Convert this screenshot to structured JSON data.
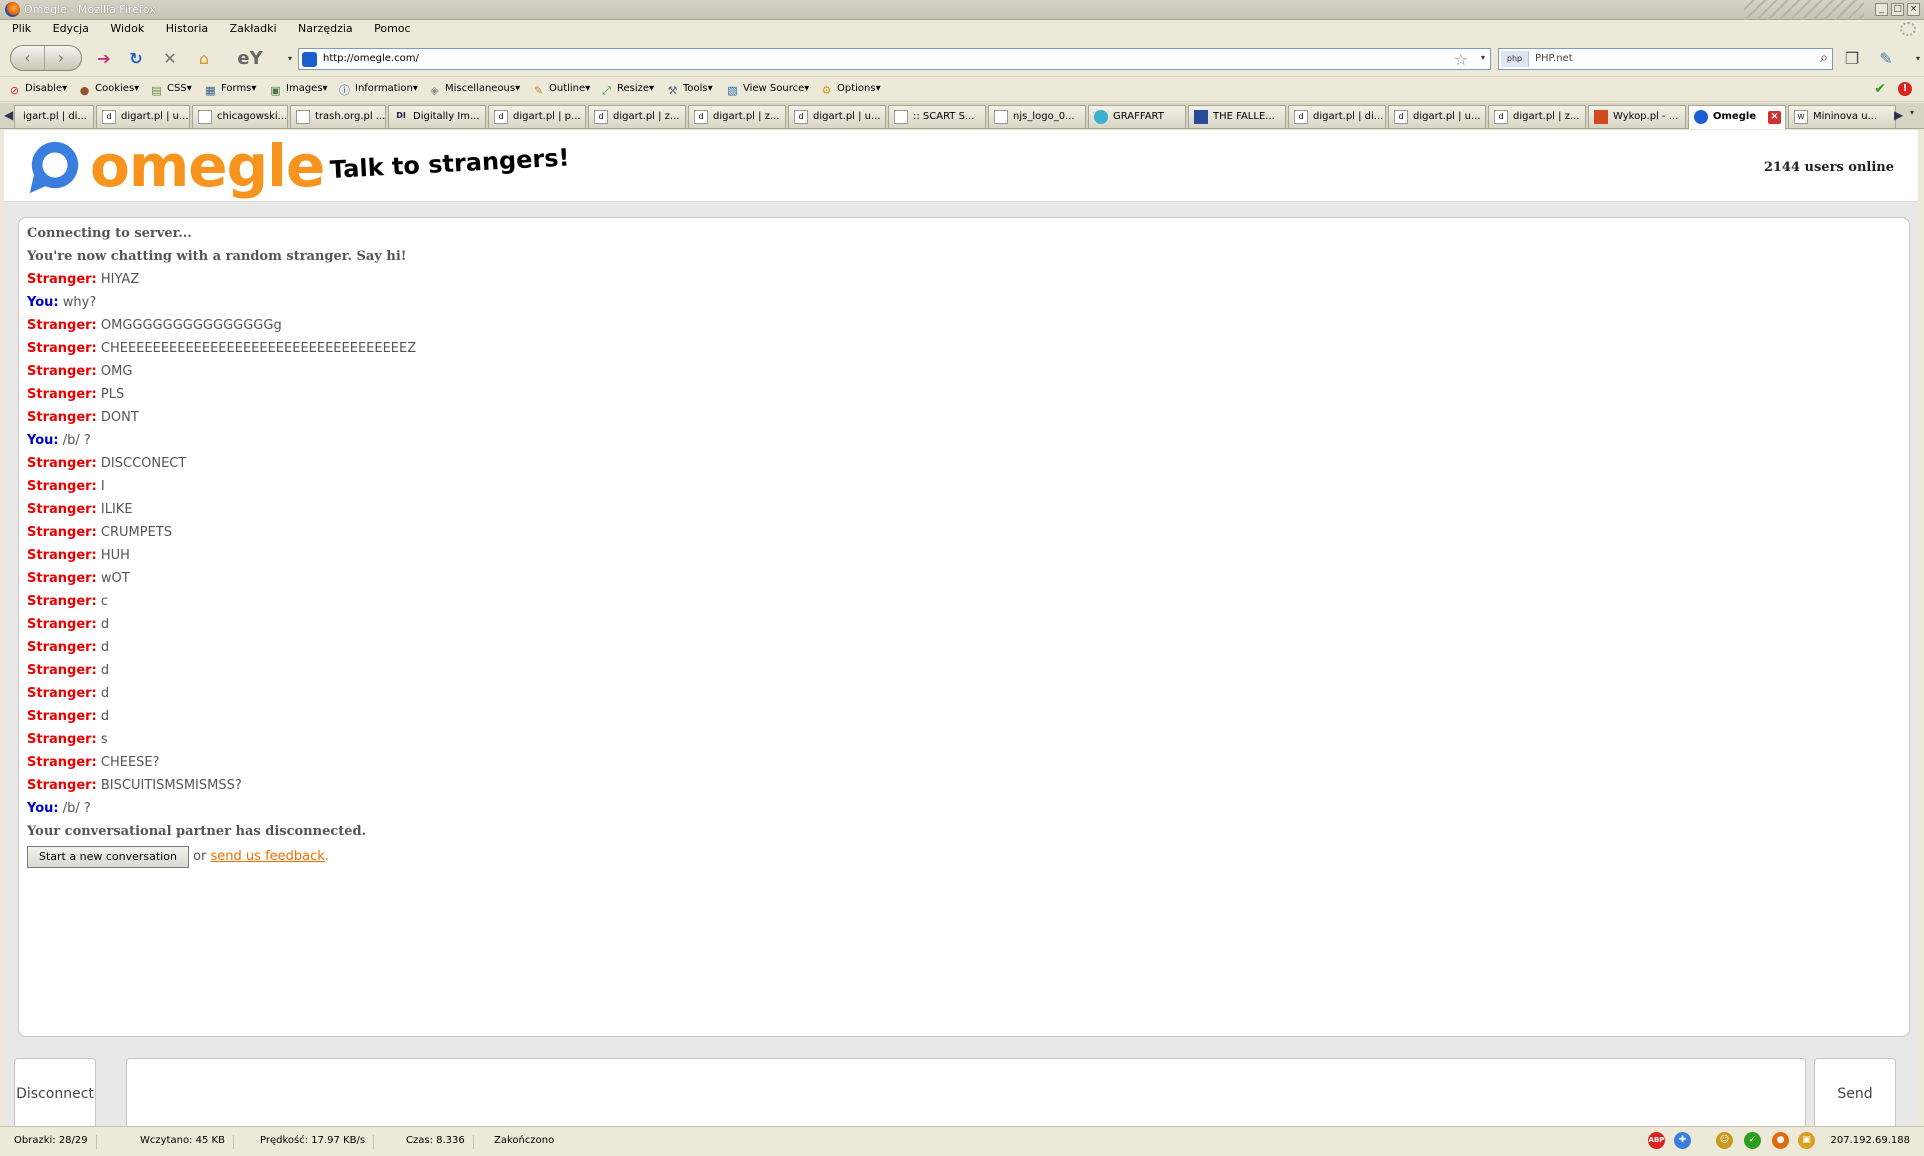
{
  "window": {
    "title": "Omegle - Mozilla Firefox"
  },
  "menu": [
    "Plik",
    "Edycja",
    "Widok",
    "Historia",
    "Zakładki",
    "Narzędzia",
    "Pomoc"
  ],
  "nav": {
    "url": "http://omegle.com/",
    "search_engine": "php",
    "search_text": "PHP.net"
  },
  "devbar": [
    "Disable",
    "Cookies",
    "CSS",
    "Forms",
    "Images",
    "Information",
    "Miscellaneous",
    "Outline",
    "Resize",
    "Tools",
    "View Source",
    "Options"
  ],
  "tabs": [
    "igart.pl | di...",
    "digart.pl | u...",
    "chicagowski...",
    "trash.org.pl ...",
    "Digitally Im...",
    "digart.pl | p...",
    "digart.pl | z...",
    "digart.pl | z...",
    "digart.pl | u...",
    ":: SCART S...",
    "njs_logo_0...",
    "GRAFFART",
    "THE FALLE...",
    "digart.pl | di...",
    "digart.pl | u...",
    "digart.pl | z...",
    "Wykop.pl - ...",
    "Omegle",
    "Mininova u..."
  ],
  "site": {
    "logo": "omegle",
    "tagline": "Talk to strangers!",
    "users_online": "2144 users online",
    "colors": {
      "logo": "#f7941d",
      "stranger": "#ee0000",
      "you": "#0000cc",
      "link": "#f06d00"
    }
  },
  "log": {
    "connecting": "Connecting to server...",
    "now_chatting": "You're now chatting with a random stranger. Say hi!",
    "messages": [
      {
        "who": "Stranger:",
        "text": "HIYAZ"
      },
      {
        "who": "You:",
        "text": "why?"
      },
      {
        "who": "Stranger:",
        "text": "OMGGGGGGGGGGGGGGGg"
      },
      {
        "who": "Stranger:",
        "text": "CHEEEEEEEEEEEEEEEEEEEEEEEEEEEEEEEEEEEZ"
      },
      {
        "who": "Stranger:",
        "text": "OMG"
      },
      {
        "who": "Stranger:",
        "text": "PLS"
      },
      {
        "who": "Stranger:",
        "text": "DONT"
      },
      {
        "who": "You:",
        "text": "/b/ ?"
      },
      {
        "who": "Stranger:",
        "text": "DISCCONECT"
      },
      {
        "who": "Stranger:",
        "text": "I"
      },
      {
        "who": "Stranger:",
        "text": "ILIKE"
      },
      {
        "who": "Stranger:",
        "text": "CRUMPETS"
      },
      {
        "who": "Stranger:",
        "text": "HUH"
      },
      {
        "who": "Stranger:",
        "text": "wOT"
      },
      {
        "who": "Stranger:",
        "text": "c"
      },
      {
        "who": "Stranger:",
        "text": "d"
      },
      {
        "who": "Stranger:",
        "text": "d"
      },
      {
        "who": "Stranger:",
        "text": "d"
      },
      {
        "who": "Stranger:",
        "text": "d"
      },
      {
        "who": "Stranger:",
        "text": "d"
      },
      {
        "who": "Stranger:",
        "text": "s"
      },
      {
        "who": "Stranger:",
        "text": "CHEESE?"
      },
      {
        "who": "Stranger:",
        "text": "BISCUITISMSMISMSS?"
      },
      {
        "who": "You:",
        "text": "/b/ ?"
      }
    ],
    "disconnected": "Your conversational partner has disconnected.",
    "new_conversation": "Start a new conversation",
    "or": "or",
    "feedback": "send us feedback",
    "period": "."
  },
  "controls": {
    "disconnect": "Disconnect",
    "send": "Send",
    "message": ""
  },
  "status": {
    "images": "Obrazki: 28/29",
    "loaded": "Wczytano: 45 KB",
    "speed": "Prędkość: 17.97 KB/s",
    "time": "Czas: 8.336",
    "state": "Zakończono",
    "ip": "207.192.69.188"
  }
}
